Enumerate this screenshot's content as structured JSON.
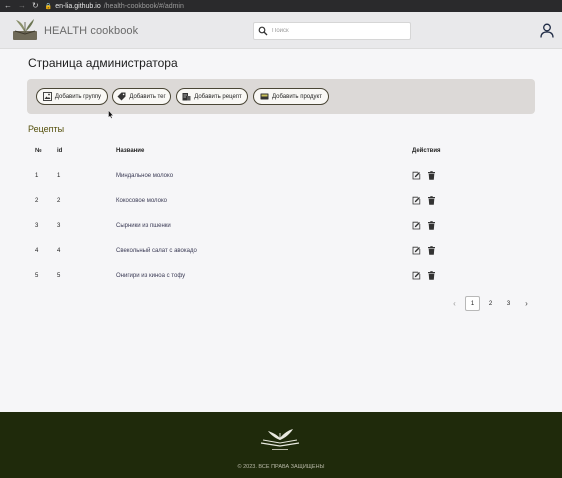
{
  "browser": {
    "back": "←",
    "forward": "→",
    "reload": "↻",
    "url_host": "en-lia.github.io",
    "url_path": "/health-cookbook/#/admin"
  },
  "header": {
    "brand": "HEALTH cookbook",
    "search_placeholder": "Поиск"
  },
  "page": {
    "title": "Страница администратора",
    "actions": [
      {
        "label": "Добавить группу",
        "icon": "image-add-icon"
      },
      {
        "label": "Добавить тег",
        "icon": "tag-icon"
      },
      {
        "label": "Добавить рецепт",
        "icon": "recipe-icon"
      },
      {
        "label": "Добавить продукт",
        "icon": "product-icon"
      }
    ]
  },
  "recipes": {
    "title": "Рецепты",
    "columns": [
      "№",
      "id",
      "Название",
      "Действия"
    ],
    "rows": [
      {
        "num": "1",
        "id": "1",
        "name": "Миндальное молоко"
      },
      {
        "num": "2",
        "id": "2",
        "name": "Кокосовое молоко"
      },
      {
        "num": "3",
        "id": "3",
        "name": "Сырники из пшенки"
      },
      {
        "num": "4",
        "id": "4",
        "name": "Свекольный салат с авокадо"
      },
      {
        "num": "5",
        "id": "5",
        "name": "Онигири из киноа с тофу"
      }
    ]
  },
  "pagination": {
    "prev": "‹",
    "pages": [
      "1",
      "2",
      "3"
    ],
    "current": "1",
    "next": "›"
  },
  "footer": {
    "copyright": "© 2023. ВСЕ ПРАВА ЗАЩИЩЕНЫ"
  },
  "colors": {
    "footer_bg": "#1f2a0b",
    "section_title": "#55500c",
    "actions_panel": "#dcd9d7"
  }
}
